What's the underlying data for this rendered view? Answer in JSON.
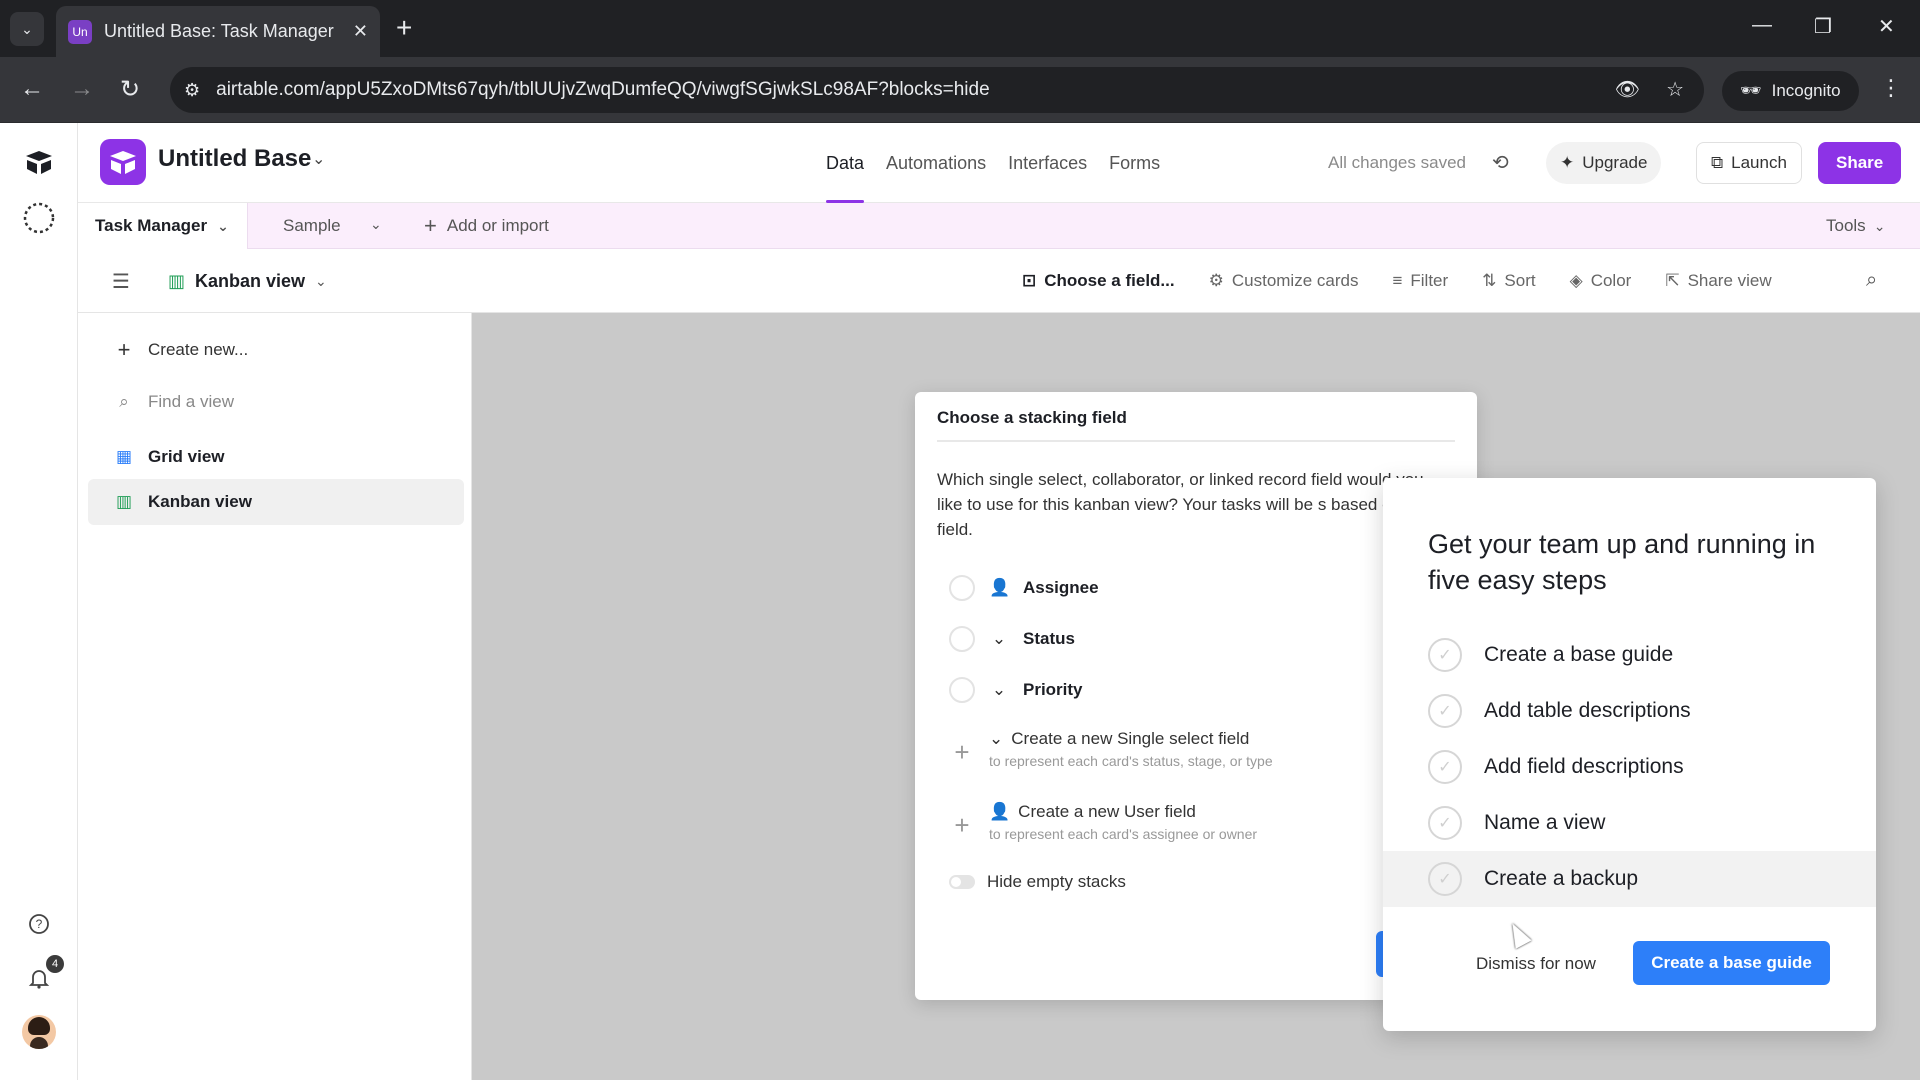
{
  "browser": {
    "tab_favicon": "Un",
    "tab_title": "Untitled Base: Task Manager - A",
    "url": "airtable.com/appU5ZxoDMts67qyh/tblUUjvZwqDumfeQQ/viwgfSGjwkSLc98AF?blocks=hide",
    "incognito_label": "Incognito"
  },
  "header": {
    "base_name": "Untitled Base",
    "tabs": [
      "Data",
      "Automations",
      "Interfaces",
      "Forms"
    ],
    "active_tab": "Data",
    "status": "All changes saved",
    "upgrade": "Upgrade",
    "launch": "Launch",
    "share": "Share"
  },
  "tablebar": {
    "table_name": "Task Manager",
    "other_table": "Sample",
    "add_import": "Add or import",
    "tools": "Tools"
  },
  "viewbar": {
    "view_name": "Kanban view",
    "tools": [
      "Choose a field...",
      "Customize cards",
      "Filter",
      "Sort",
      "Color",
      "Share view"
    ]
  },
  "sidebar": {
    "create_new": "Create new...",
    "find_placeholder": "Find a view",
    "views": [
      {
        "label": "Grid view",
        "selected": false
      },
      {
        "label": "Kanban view",
        "selected": true
      }
    ]
  },
  "notifications": {
    "count": "4"
  },
  "stacking_dialog": {
    "title": "Choose a stacking field",
    "description": "Which single select, collaborator, or linked record field would you like to use for this kanban view? Your tasks will be s based on this field.",
    "options": [
      "Assignee",
      "Status",
      "Priority"
    ],
    "create_options": [
      {
        "label": "Create a new Single select field",
        "sub": "to represent each card's status, stage, or type"
      },
      {
        "label": "Create a new User field",
        "sub": "to represent each card's assignee or owner"
      }
    ],
    "hide_empty": "Hide empty stacks"
  },
  "guide": {
    "title": "Get your team up and running in five easy steps",
    "steps": [
      "Create a base guide",
      "Add table descriptions",
      "Add field descriptions",
      "Name a view",
      "Create a backup"
    ],
    "dismiss": "Dismiss for now",
    "cta": "Create a base guide"
  },
  "colors": {
    "accent": "#8d33e6",
    "primary_button": "#2d7ff9",
    "tablebar_bg": "#fbeefc"
  }
}
